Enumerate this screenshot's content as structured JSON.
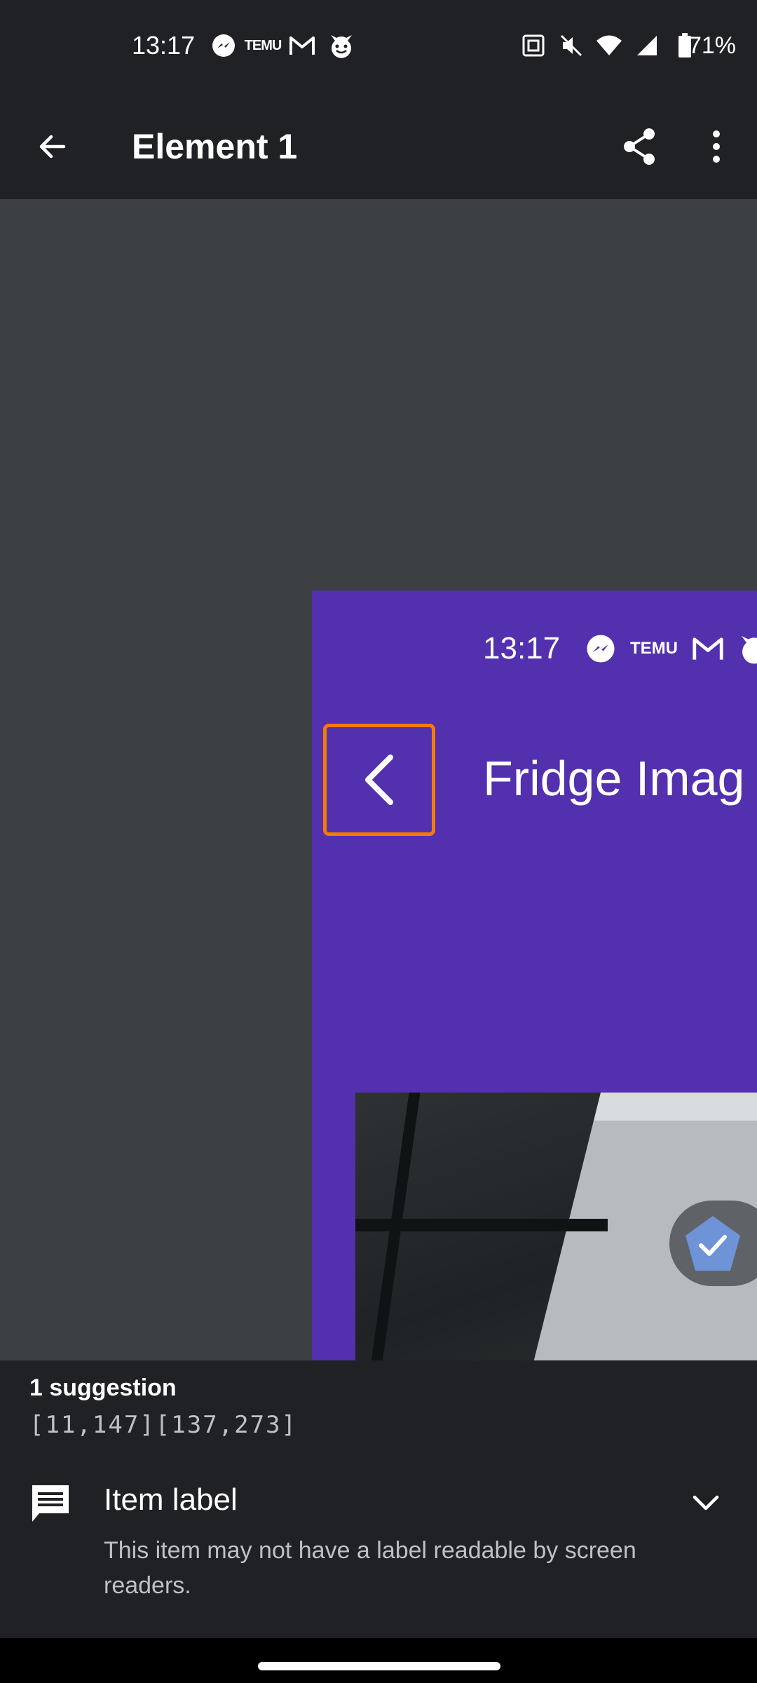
{
  "status_bar": {
    "time": "13:17",
    "left_icons": [
      "messenger-icon",
      "temu-icon",
      "gmail-icon",
      "devil-icon"
    ],
    "temu_text": "TEMU",
    "right_icons": [
      "nfc-icon",
      "mute-icon",
      "wifi-icon",
      "signal-icon",
      "battery-icon"
    ],
    "battery": "71%"
  },
  "app_bar": {
    "title": "Element 1",
    "back_icon": "arrow-back-icon",
    "share_icon": "share-icon",
    "more_icon": "more-vert-icon"
  },
  "preview": {
    "time": "13:17",
    "temu_text": "TEMU",
    "title": "Fridge Imag",
    "highlight_color": "#f57c00",
    "background_color": "#5230ae"
  },
  "suggestions": {
    "count_label": "1 suggestion",
    "coordinates": "[11,147][137,273]",
    "items": [
      {
        "icon": "comment-icon",
        "label": "Item label",
        "description": "This item may not have a label readable by screen readers."
      }
    ]
  }
}
